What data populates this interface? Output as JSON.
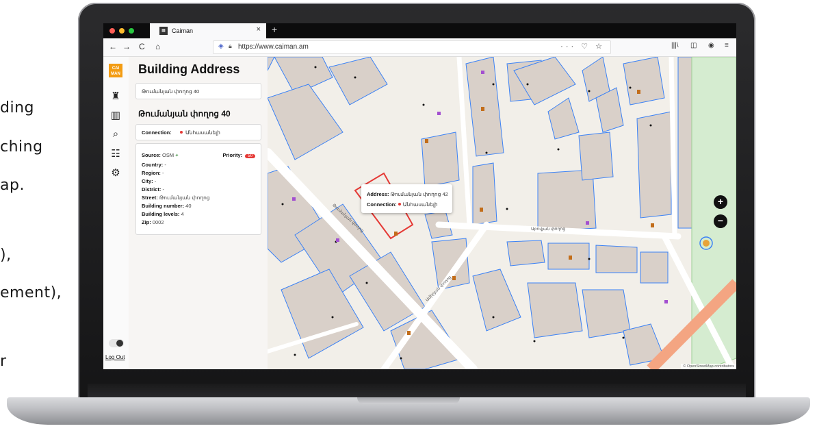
{
  "slide_fragments": [
    "ding",
    "ching",
    "ap.",
    "),",
    "ement),",
    "r"
  ],
  "browser": {
    "tab_title": "Caiman",
    "tab_close": "×",
    "new_tab": "+",
    "url": "https://www.caiman.am",
    "url_actions": "··· ♡ ☆",
    "back_icon": "←",
    "forward_icon": "→",
    "reload_icon": "C",
    "home_icon": "⌂"
  },
  "app": {
    "logo_text": "CAI MAN",
    "logout_label": "Log Out",
    "panel_title": "Building Address",
    "address_value": "Թումանյան փողոց 40",
    "building_heading": "Թումանյան փողոց 40",
    "connection_label": "Connection:",
    "connection_value": "Անհասանելի",
    "source_label": "Source:",
    "source_value": "OSM",
    "priority_label": "Priority:",
    "priority_value": "50",
    "fields": [
      {
        "label": "Country:",
        "value": "-"
      },
      {
        "label": "Region:",
        "value": "-"
      },
      {
        "label": "City:",
        "value": "-"
      },
      {
        "label": "District:",
        "value": "-"
      },
      {
        "label": "Street:",
        "value": "Թումանյան փողոց"
      },
      {
        "label": "Building number:",
        "value": "40"
      },
      {
        "label": "Building levels:",
        "value": "4"
      },
      {
        "label": "Zip:",
        "value": "0002"
      }
    ]
  },
  "map": {
    "popup_address_label": "Address:",
    "popup_address_value": "Թումանյան փողոց 42",
    "popup_connection_label": "Connection:",
    "popup_connection_value": "Անհասանելի",
    "zoom_in": "+",
    "zoom_out": "−",
    "street_labels": [
      "Թումանյան փողոց",
      "Աբովյան փողոց",
      "Ամիրյան փողոց"
    ],
    "attribution": "© OpenStreetMap contributors",
    "colors": {
      "road": "#ffffff",
      "building": "#d9d0c9",
      "outline": "#3b82f6",
      "selected": "#e53935",
      "park": "#d5ecd0"
    }
  }
}
